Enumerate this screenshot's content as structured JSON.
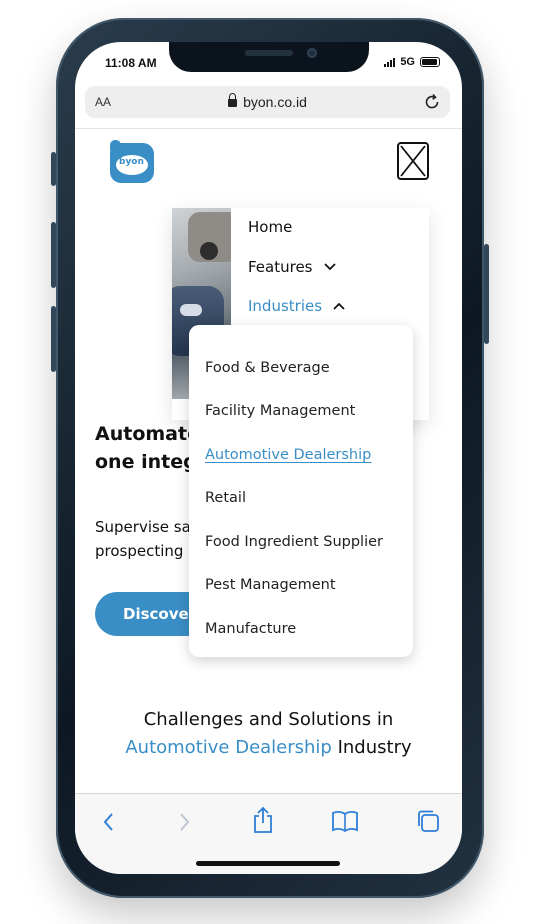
{
  "status": {
    "time": "11:08 AM",
    "network": "5G"
  },
  "browser": {
    "aa_label": "AA",
    "url": "byon.co.id"
  },
  "logo": {
    "text": "byon"
  },
  "nav": {
    "items": [
      {
        "label": "Home"
      },
      {
        "label": "Features"
      },
      {
        "label": "Industries"
      }
    ]
  },
  "industries_dropdown": {
    "items": [
      {
        "label": "Food & Beverage"
      },
      {
        "label": "Facility Management"
      },
      {
        "label": "Automotive Dealership"
      },
      {
        "label": "Retail"
      },
      {
        "label": "Food Ingredient Supplier"
      },
      {
        "label": "Pest Management"
      },
      {
        "label": "Manufacture"
      }
    ]
  },
  "hero": {
    "title_line1": "Automate",
    "title_line2": "one integr",
    "subtitle_line1": "Supervise sa",
    "subtitle_line2": "prospecting",
    "cta_label": "Discover"
  },
  "section": {
    "title_line1": "Challenges and Solutions in",
    "title_highlight": "Automotive Dealership",
    "title_suffix": " Industry"
  },
  "colors": {
    "accent": "#3a8ec6",
    "text": "#111111"
  }
}
